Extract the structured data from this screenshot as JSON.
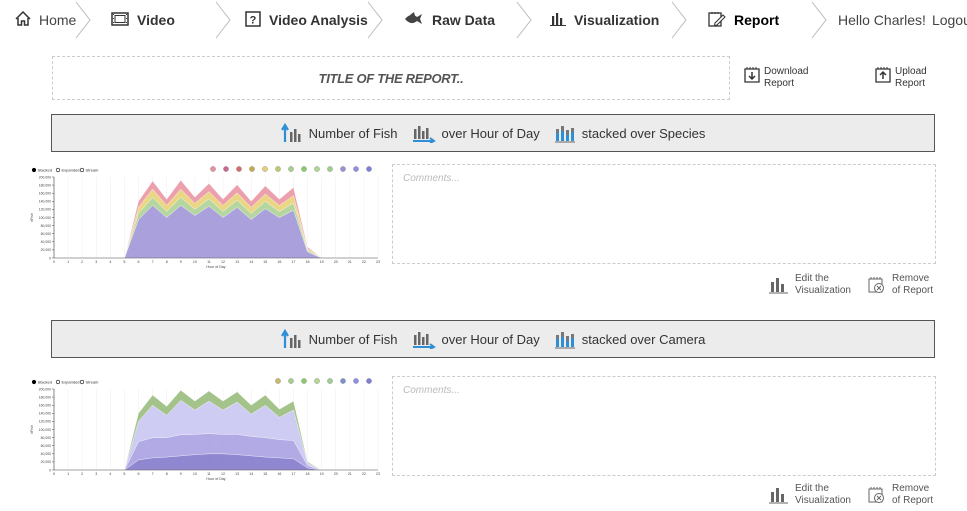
{
  "nav": {
    "home": "Home",
    "items": [
      "Video",
      "Video Analysis",
      "Raw Data",
      "Visualization",
      "Report"
    ],
    "active": "Report",
    "greeting": "Hello Charles!",
    "logout": "Logout"
  },
  "report": {
    "title_placeholder": "TITLE OF THE REPORT..",
    "download_label": [
      "Download",
      "Report"
    ],
    "upload_label": [
      "Upload",
      "Report"
    ]
  },
  "sections": [
    {
      "header": {
        "count": "Number of Fish",
        "over": "over Hour of Day",
        "stacked": "stacked over Species"
      },
      "comments_placeholder": "Comments...",
      "edit_label": [
        "Edit the",
        "Visualization"
      ],
      "remove_label": [
        "Remove",
        "of Report"
      ]
    },
    {
      "header": {
        "count": "Number of Fish",
        "over": "over Hour of Day",
        "stacked": "stacked over Camera"
      },
      "comments_placeholder": "Comments...",
      "edit_label": [
        "Edit the",
        "Visualization"
      ],
      "remove_label": [
        "Remove",
        "of Report"
      ]
    }
  ],
  "colors": {
    "accent": "#2f8fd6",
    "header_bg": "#ececec"
  },
  "chart_data": [
    {
      "type": "area",
      "xlabel": "Hour of Day",
      "ylabel": "#Fish",
      "legend": [
        "Stacked",
        "Expanded",
        "Stream"
      ],
      "x": [
        0,
        1,
        2,
        3,
        4,
        5,
        6,
        7,
        8,
        9,
        10,
        11,
        12,
        13,
        14,
        15,
        16,
        17,
        18,
        19,
        20,
        21,
        22,
        23
      ],
      "ylim": [
        0,
        200000
      ],
      "yticks": [
        0,
        20000,
        40000,
        60000,
        80000,
        100000,
        120000,
        140000,
        160000,
        180000,
        200000
      ],
      "series": [
        {
          "color": "#9b8fd6",
          "values": [
            0,
            0,
            0,
            0,
            0,
            0,
            95000,
            130000,
            100000,
            130000,
            105000,
            128000,
            100000,
            125000,
            95000,
            122000,
            100000,
            118000,
            15000,
            0,
            0,
            0,
            0,
            0
          ]
        },
        {
          "color": "#a9cf8f",
          "values": [
            0,
            0,
            0,
            0,
            0,
            0,
            15000,
            20000,
            15000,
            20000,
            15000,
            18000,
            15000,
            18000,
            15000,
            18000,
            15000,
            18000,
            4000,
            0,
            0,
            0,
            0,
            0
          ]
        },
        {
          "color": "#e6cf6f",
          "values": [
            0,
            0,
            0,
            0,
            0,
            0,
            15000,
            20000,
            15000,
            20000,
            15000,
            18000,
            15000,
            18000,
            15000,
            18000,
            15000,
            18000,
            4000,
            0,
            0,
            0,
            0,
            0
          ]
        },
        {
          "color": "#e98f9f",
          "values": [
            0,
            0,
            0,
            0,
            0,
            0,
            15000,
            20000,
            15000,
            22000,
            15000,
            20000,
            15000,
            20000,
            15000,
            20000,
            15000,
            20000,
            4000,
            0,
            0,
            0,
            0,
            0
          ]
        }
      ],
      "legend_dots": [
        "#e98f9f",
        "#c86b8f",
        "#d76b6b",
        "#c9a94f",
        "#e6cf6f",
        "#b8cf6f",
        "#a9cf8f",
        "#8fc96f",
        "#b2d98f",
        "#9fcf8f",
        "#9b8fd6",
        "#8f8fe6",
        "#7f7fd6"
      ]
    },
    {
      "type": "area",
      "xlabel": "Hour of Day",
      "ylabel": "#Fish",
      "legend": [
        "Stacked",
        "Expanded",
        "Stream"
      ],
      "x": [
        0,
        1,
        2,
        3,
        4,
        5,
        6,
        7,
        8,
        9,
        10,
        11,
        12,
        13,
        14,
        15,
        16,
        17,
        18,
        19,
        20,
        21,
        22,
        23
      ],
      "ylim": [
        0,
        200000
      ],
      "yticks": [
        0,
        20000,
        40000,
        60000,
        80000,
        100000,
        120000,
        140000,
        160000,
        180000,
        200000
      ],
      "series": [
        {
          "color": "#7d72c9",
          "values": [
            0,
            0,
            0,
            0,
            0,
            0,
            25000,
            30000,
            32000,
            35000,
            38000,
            40000,
            40000,
            38000,
            35000,
            32000,
            30000,
            28000,
            5000,
            0,
            0,
            0,
            0,
            0
          ]
        },
        {
          "color": "#a39bdf",
          "values": [
            0,
            0,
            0,
            0,
            0,
            0,
            45000,
            50000,
            48000,
            52000,
            50000,
            50000,
            48000,
            50000,
            48000,
            48000,
            45000,
            45000,
            6000,
            0,
            0,
            0,
            0,
            0
          ]
        },
        {
          "color": "#c6c3f0",
          "values": [
            0,
            0,
            0,
            0,
            0,
            0,
            50000,
            80000,
            55000,
            85000,
            60000,
            80000,
            60000,
            80000,
            55000,
            80000,
            55000,
            75000,
            6000,
            0,
            0,
            0,
            0,
            0
          ]
        },
        {
          "color": "#94b877",
          "values": [
            0,
            0,
            0,
            0,
            0,
            0,
            20000,
            25000,
            22000,
            25000,
            22000,
            25000,
            22000,
            25000,
            22000,
            25000,
            20000,
            22000,
            3000,
            0,
            0,
            0,
            0,
            0
          ]
        }
      ],
      "legend_dots": [
        "#c9b86f",
        "#a9cf8f",
        "#8fc96f",
        "#b2d98f",
        "#9fcf8f",
        "#7f8fd6",
        "#8f8fe6",
        "#7f7fd6"
      ]
    }
  ]
}
